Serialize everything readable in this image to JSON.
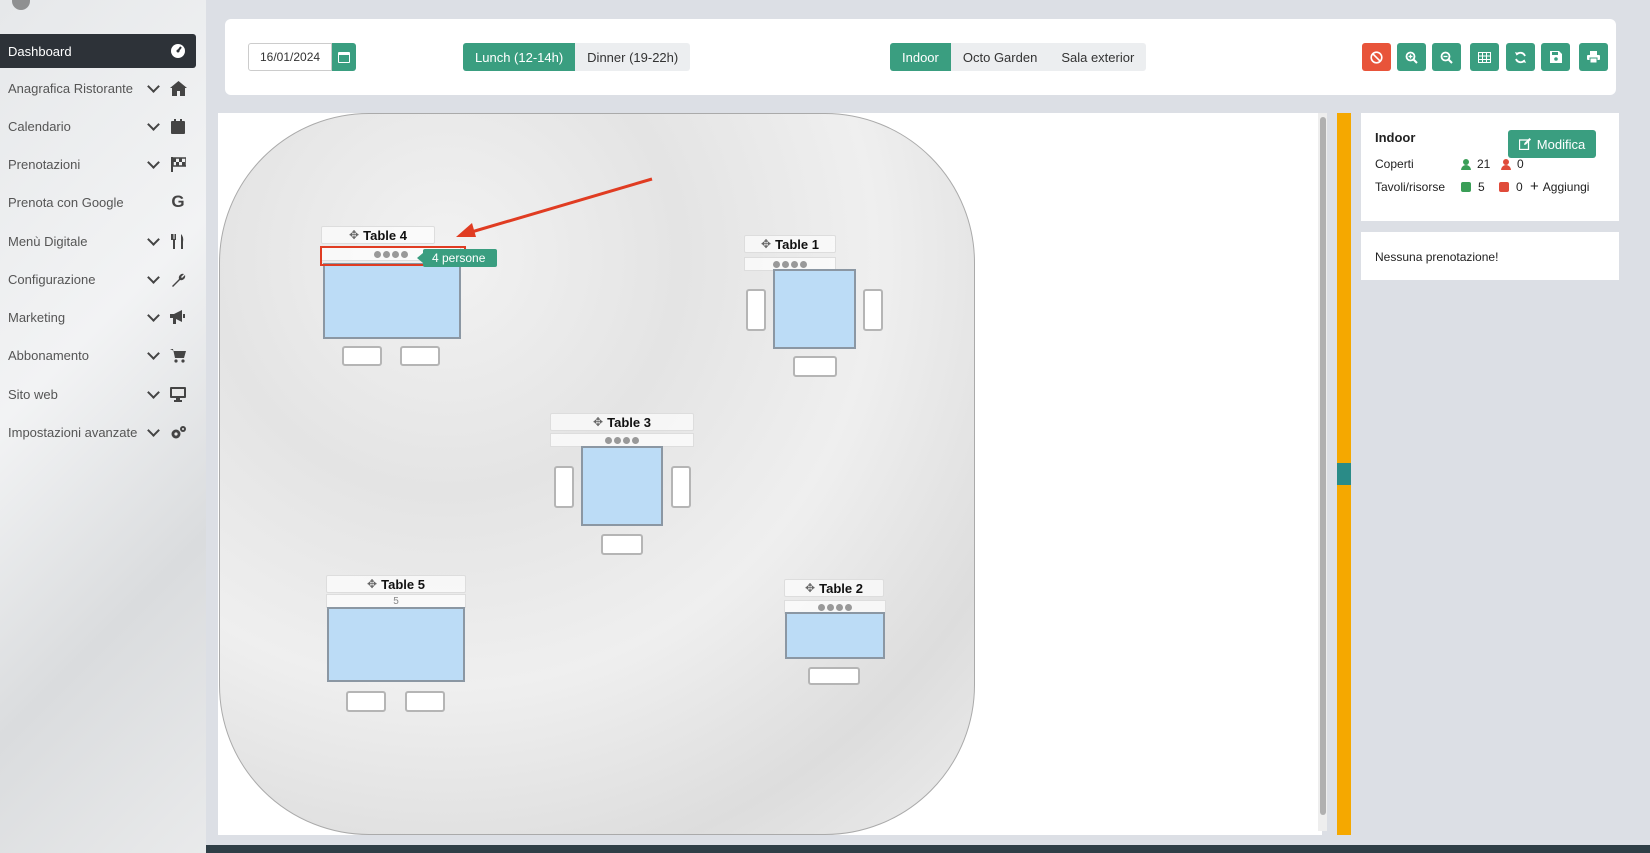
{
  "sidebar": {
    "items": [
      {
        "label": "Dashboard",
        "icon": "dashboard-gauge-icon",
        "active": true
      },
      {
        "label": "Anagrafica Ristorante",
        "icon": "home-icon"
      },
      {
        "label": "Calendario",
        "icon": "calendar-icon"
      },
      {
        "label": "Prenotazioni",
        "icon": "checkered-flag-icon"
      },
      {
        "label": "Prenota con Google",
        "icon": "google-icon"
      },
      {
        "label": "Menù Digitale",
        "icon": "utensils-icon"
      },
      {
        "label": "Configurazione",
        "icon": "wrench-icon"
      },
      {
        "label": "Marketing",
        "icon": "megaphone-icon"
      },
      {
        "label": "Abbonamento",
        "icon": "cart-icon"
      },
      {
        "label": "Sito web",
        "icon": "monitor-icon"
      },
      {
        "label": "Impostazioni avanzate",
        "icon": "gears-icon"
      }
    ]
  },
  "toolbar": {
    "date_value": "16/01/2024",
    "services": [
      {
        "label": "Lunch (12-14h)",
        "selected": true
      },
      {
        "label": "Dinner (19-22h)",
        "selected": false
      }
    ],
    "rooms": [
      {
        "label": "Indoor",
        "selected": true
      },
      {
        "label": "Octo Garden",
        "selected": false
      },
      {
        "label": "Sala exterior",
        "selected": false
      }
    ],
    "action_icons": [
      "ban-icon",
      "zoom-in-icon",
      "zoom-out-icon",
      "grid-icon",
      "refresh-icon",
      "save-icon",
      "print-icon"
    ],
    "accent_color": "#3a9e80",
    "danger_color": "#e8543a"
  },
  "floor_plan": {
    "tables": [
      {
        "name": "Table 4"
      },
      {
        "name": "Table 1"
      },
      {
        "name": "Table 3"
      },
      {
        "name": "Table 5",
        "capacity_hint": "5"
      },
      {
        "name": "Table 2"
      }
    ],
    "drag_badge": "4 persone"
  },
  "info_panel": {
    "title": "Indoor",
    "edit_label": "Modifica",
    "coperti_label": "Coperti",
    "coperti_ok": "21",
    "coperti_ko": "0",
    "tavoli_label": "Tavoli/risorse",
    "tavoli_ok": "5",
    "tavoli_ko": "0",
    "add_label": "Aggiungi",
    "no_bookings": "Nessuna prenotazione!"
  }
}
